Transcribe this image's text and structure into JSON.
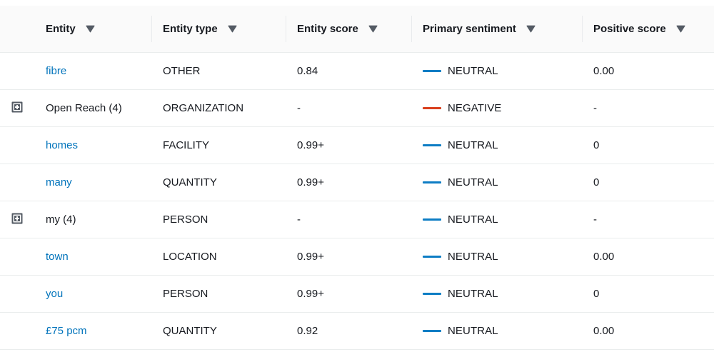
{
  "table": {
    "columns": [
      {
        "id": "expand",
        "label": "",
        "sortable": false
      },
      {
        "id": "entity",
        "label": "Entity",
        "sortable": true,
        "sort_icon": "sort-descending-icon"
      },
      {
        "id": "type",
        "label": "Entity type",
        "sortable": true,
        "sort_icon": "sort-descending-icon"
      },
      {
        "id": "escore",
        "label": "Entity score",
        "sortable": true,
        "sort_icon": "sort-descending-icon"
      },
      {
        "id": "sentiment",
        "label": "Primary sentiment",
        "sortable": true,
        "sort_icon": "sort-descending-icon"
      },
      {
        "id": "pscore",
        "label": "Positive score",
        "sortable": true,
        "sort_icon": "sort-descending-icon"
      }
    ],
    "rows": [
      {
        "expandable": false,
        "expand_icon": "",
        "entity": "fibre",
        "entity_is_link": true,
        "entity_type": "OTHER",
        "entity_score": "0.84",
        "sentiment": "NEUTRAL",
        "sentiment_color": "#0d7dc4",
        "positive_score": "0.00"
      },
      {
        "expandable": true,
        "expand_icon": "expand-plus-icon",
        "entity": "Open Reach (4)",
        "entity_is_link": false,
        "entity_type": "ORGANIZATION",
        "entity_score": "-",
        "sentiment": "NEGATIVE",
        "sentiment_color": "#d93f1d",
        "positive_score": "-"
      },
      {
        "expandable": false,
        "expand_icon": "",
        "entity": "homes",
        "entity_is_link": true,
        "entity_type": "FACILITY",
        "entity_score": "0.99+",
        "sentiment": "NEUTRAL",
        "sentiment_color": "#0d7dc4",
        "positive_score": "0"
      },
      {
        "expandable": false,
        "expand_icon": "",
        "entity": "many",
        "entity_is_link": true,
        "entity_type": "QUANTITY",
        "entity_score": "0.99+",
        "sentiment": "NEUTRAL",
        "sentiment_color": "#0d7dc4",
        "positive_score": "0"
      },
      {
        "expandable": true,
        "expand_icon": "expand-plus-icon",
        "entity": "my (4)",
        "entity_is_link": false,
        "entity_type": "PERSON",
        "entity_score": "-",
        "sentiment": "NEUTRAL",
        "sentiment_color": "#0d7dc4",
        "positive_score": "-"
      },
      {
        "expandable": false,
        "expand_icon": "",
        "entity": "town",
        "entity_is_link": true,
        "entity_type": "LOCATION",
        "entity_score": "0.99+",
        "sentiment": "NEUTRAL",
        "sentiment_color": "#0d7dc4",
        "positive_score": "0.00"
      },
      {
        "expandable": false,
        "expand_icon": "",
        "entity": "you",
        "entity_is_link": true,
        "entity_type": "PERSON",
        "entity_score": "0.99+",
        "sentiment": "NEUTRAL",
        "sentiment_color": "#0d7dc4",
        "positive_score": "0"
      },
      {
        "expandable": false,
        "expand_icon": "",
        "entity": "£75 pcm",
        "entity_is_link": true,
        "entity_type": "QUANTITY",
        "entity_score": "0.92",
        "sentiment": "NEUTRAL",
        "sentiment_color": "#0d7dc4",
        "positive_score": "0.00"
      }
    ]
  },
  "colors": {
    "link": "#0073bb",
    "neutral": "#0d7dc4",
    "negative": "#d93f1d",
    "header_bg": "#fafafa",
    "border": "#eaeded",
    "text": "#16191f"
  }
}
